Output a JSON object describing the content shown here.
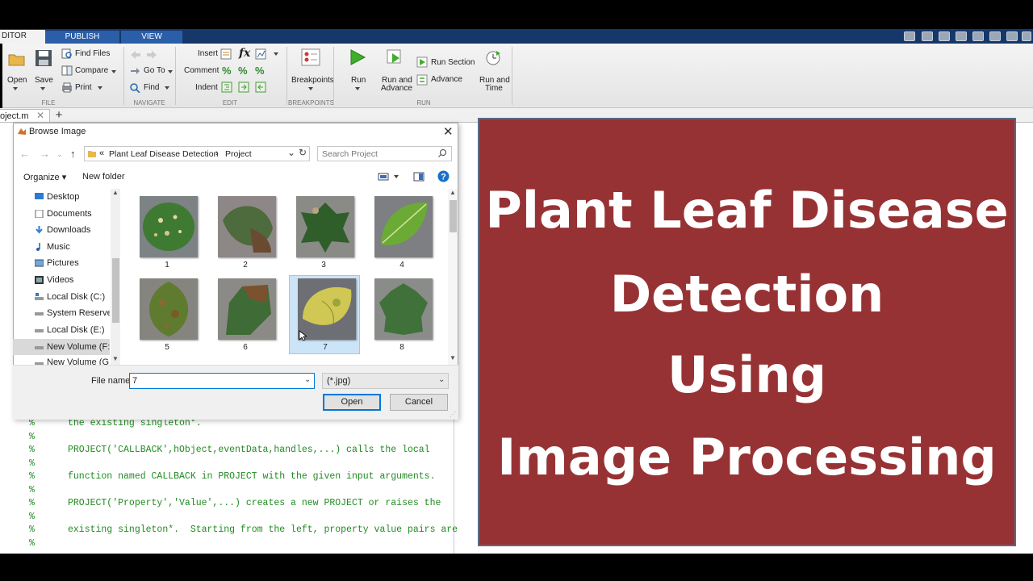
{
  "ribbon": {
    "tabs": [
      "DITOR",
      "PUBLISH",
      "VIEW"
    ],
    "file_section": {
      "open": "Open",
      "save": "Save",
      "find_files": "Find Files",
      "compare": "Compare",
      "print": "Print",
      "label": "FILE"
    },
    "navigate_section": {
      "go_to": "Go To",
      "find": "Find",
      "label": "NAVIGATE"
    },
    "edit_section": {
      "insert": "Insert",
      "comment": "Comment",
      "indent": "Indent",
      "label": "EDIT"
    },
    "breakpoints_section": {
      "breakpoints": "Breakpoints",
      "label": "BREAKPOINTS"
    },
    "run_section": {
      "run": "Run",
      "run_and_advance_1": "Run and",
      "run_and_advance_2": "Advance",
      "run_section": "Run Section",
      "advance": "Advance",
      "run_and_time_1": "Run and",
      "run_and_time_2": "Time",
      "label": "RUN"
    }
  },
  "file_tab": {
    "name": "oject.m",
    "close": "✕",
    "add": "+"
  },
  "dialog": {
    "title": "Browse Image",
    "path_prefix": "«",
    "path_folder": "Plant Leaf Disease Detection",
    "path_sep": "›",
    "path_sub": "Project",
    "search_placeholder": "Search Project",
    "organize": "Organize ▾",
    "new_folder": "New folder",
    "nav_items": [
      "Desktop",
      "Documents",
      "Downloads",
      "Music",
      "Pictures",
      "Videos",
      "Local Disk (C:)",
      "System Reserved (",
      "Local Disk (E:)",
      "New Volume (F:)",
      "New Volume (G:)"
    ],
    "thumbnails": [
      "1",
      "2",
      "3",
      "4",
      "5",
      "6",
      "7",
      "8"
    ],
    "file_name_label": "File name:",
    "file_name_value": "7",
    "file_type": "(*.jpg)",
    "open_button": "Open",
    "cancel_button": "Cancel"
  },
  "code_lines": [
    "the existing singleton*.",
    "PROJECT('CALLBACK',hObject,eventData,handles,...) calls the local",
    "function named CALLBACK in PROJECT with the given input arguments.",
    "PROJECT('Property','Value',...) creates a new PROJECT or raises the",
    "existing singleton*.  Starting from the left, property value pairs are"
  ],
  "comment_char": "%",
  "banner": {
    "line1": "Plant Leaf Disease",
    "line2": "Detection",
    "line3": "Using",
    "line4": "Image Processing"
  },
  "colors": {
    "banner_bg": "#973234",
    "ribbon_tab": "#2a5ea8",
    "comment_green": "#228b22",
    "selection": "#cce4f7"
  }
}
